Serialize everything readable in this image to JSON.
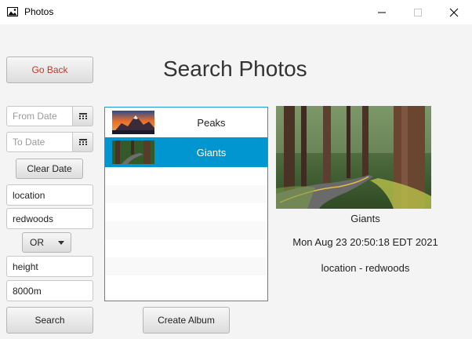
{
  "window": {
    "title": "Photos"
  },
  "page": {
    "title": "Search Photos"
  },
  "buttons": {
    "go_back": "Go Back",
    "clear_date": "Clear Date",
    "search": "Search",
    "create_album": "Create Album"
  },
  "filters": {
    "from_date_placeholder": "From Date",
    "to_date_placeholder": "To Date",
    "tag1_name": "location",
    "tag1_value": "redwoods",
    "operator": "OR",
    "tag2_name": "height",
    "tag2_value": "8000m"
  },
  "photo_list": {
    "items": [
      {
        "label": "Peaks",
        "selected": false
      },
      {
        "label": "Giants",
        "selected": true
      }
    ]
  },
  "details": {
    "caption": "Giants",
    "date": "Mon Aug 23 20:50:18 EDT 2021",
    "tag": "location - redwoods"
  },
  "colors": {
    "selection": "#0196d0",
    "list_border": "#1c98d6",
    "go_back_text": "#c0392b"
  }
}
